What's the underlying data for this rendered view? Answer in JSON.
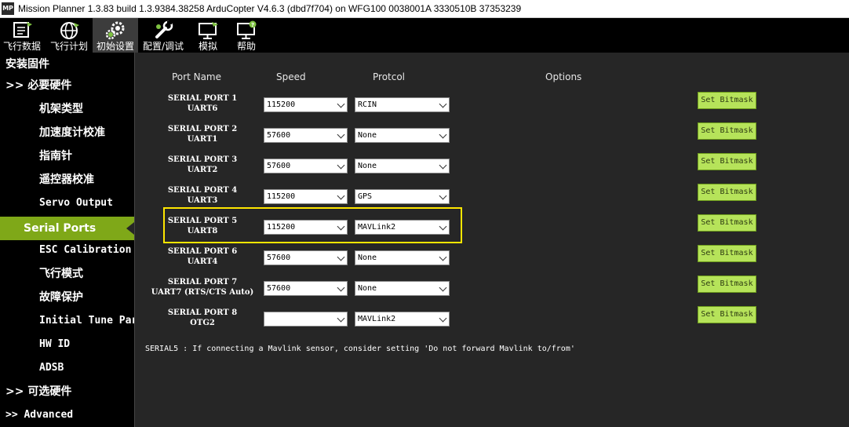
{
  "window": {
    "app_icon_text": "MP",
    "title": "Mission Planner 1.3.83 build 1.3.9384.38258 ArduCopter V4.6.3 (dbd7f704) on WFG100 0038001A 3330510B 37353239"
  },
  "toolbar": {
    "items": [
      {
        "label": "飞行数据",
        "icon": "flight-data-icon"
      },
      {
        "label": "飞行计划",
        "icon": "globe-icon"
      },
      {
        "label": "初始设置",
        "icon": "gears-icon"
      },
      {
        "label": "配置/调试",
        "icon": "wrench-icon"
      },
      {
        "label": "模拟",
        "icon": "monitor-plane-icon"
      },
      {
        "label": "帮助",
        "icon": "monitor-help-icon"
      }
    ],
    "active_index": 2
  },
  "sidebar": {
    "items": [
      {
        "label": "安装固件"
      },
      {
        "label": ">> 必要硬件"
      },
      {
        "label": "机架类型"
      },
      {
        "label": "加速度计校准"
      },
      {
        "label": "指南针"
      },
      {
        "label": "遥控器校准"
      },
      {
        "label": "Servo Output"
      },
      {
        "label": "Serial Ports"
      },
      {
        "label": "ESC Calibration"
      },
      {
        "label": "飞行模式"
      },
      {
        "label": "故障保护"
      },
      {
        "label": "Initial Tune Parameters"
      },
      {
        "label": "HW ID"
      },
      {
        "label": "ADSB"
      },
      {
        "label": ">> 可选硬件"
      },
      {
        "label": ">> Advanced"
      }
    ],
    "selected_index": 7
  },
  "serial": {
    "headers": {
      "port_name": "Port Name",
      "speed": "Speed",
      "protocol": "Protcol",
      "options": "Options"
    },
    "bitmask_label": "Set Bitmask",
    "ports": [
      {
        "name": "SERIAL PORT 1",
        "uart": "UART6",
        "speed": "115200",
        "protocol": "RCIN"
      },
      {
        "name": "SERIAL PORT 2",
        "uart": "UART1",
        "speed": "57600",
        "protocol": "None"
      },
      {
        "name": "SERIAL PORT 3",
        "uart": "UART2",
        "speed": "57600",
        "protocol": "None"
      },
      {
        "name": "SERIAL PORT 4",
        "uart": "UART3",
        "speed": "115200",
        "protocol": "GPS"
      },
      {
        "name": "SERIAL PORT 5",
        "uart": "UART8",
        "speed": "115200",
        "protocol": "MAVLink2"
      },
      {
        "name": "SERIAL PORT 6",
        "uart": "UART4",
        "speed": "57600",
        "protocol": "None"
      },
      {
        "name": "SERIAL PORT 7",
        "uart": "UART7 (RTS/CTS Auto)",
        "speed": "57600",
        "protocol": "None"
      },
      {
        "name": "SERIAL PORT 8",
        "uart": "OTG2",
        "speed": "",
        "protocol": "MAVLink2"
      }
    ],
    "highlighted_port_index": 4,
    "note": "SERIAL5 : If connecting a Mavlink sensor, consider setting 'Do not forward Mavlink to/from'"
  },
  "colors": {
    "toolbar_bg": "#000000",
    "sidebar_bg": "#000000",
    "content_bg": "#262626",
    "selected_item": "#7fa818",
    "bitmask_button": "#b6e35a",
    "highlight_border": "#ffe600"
  }
}
